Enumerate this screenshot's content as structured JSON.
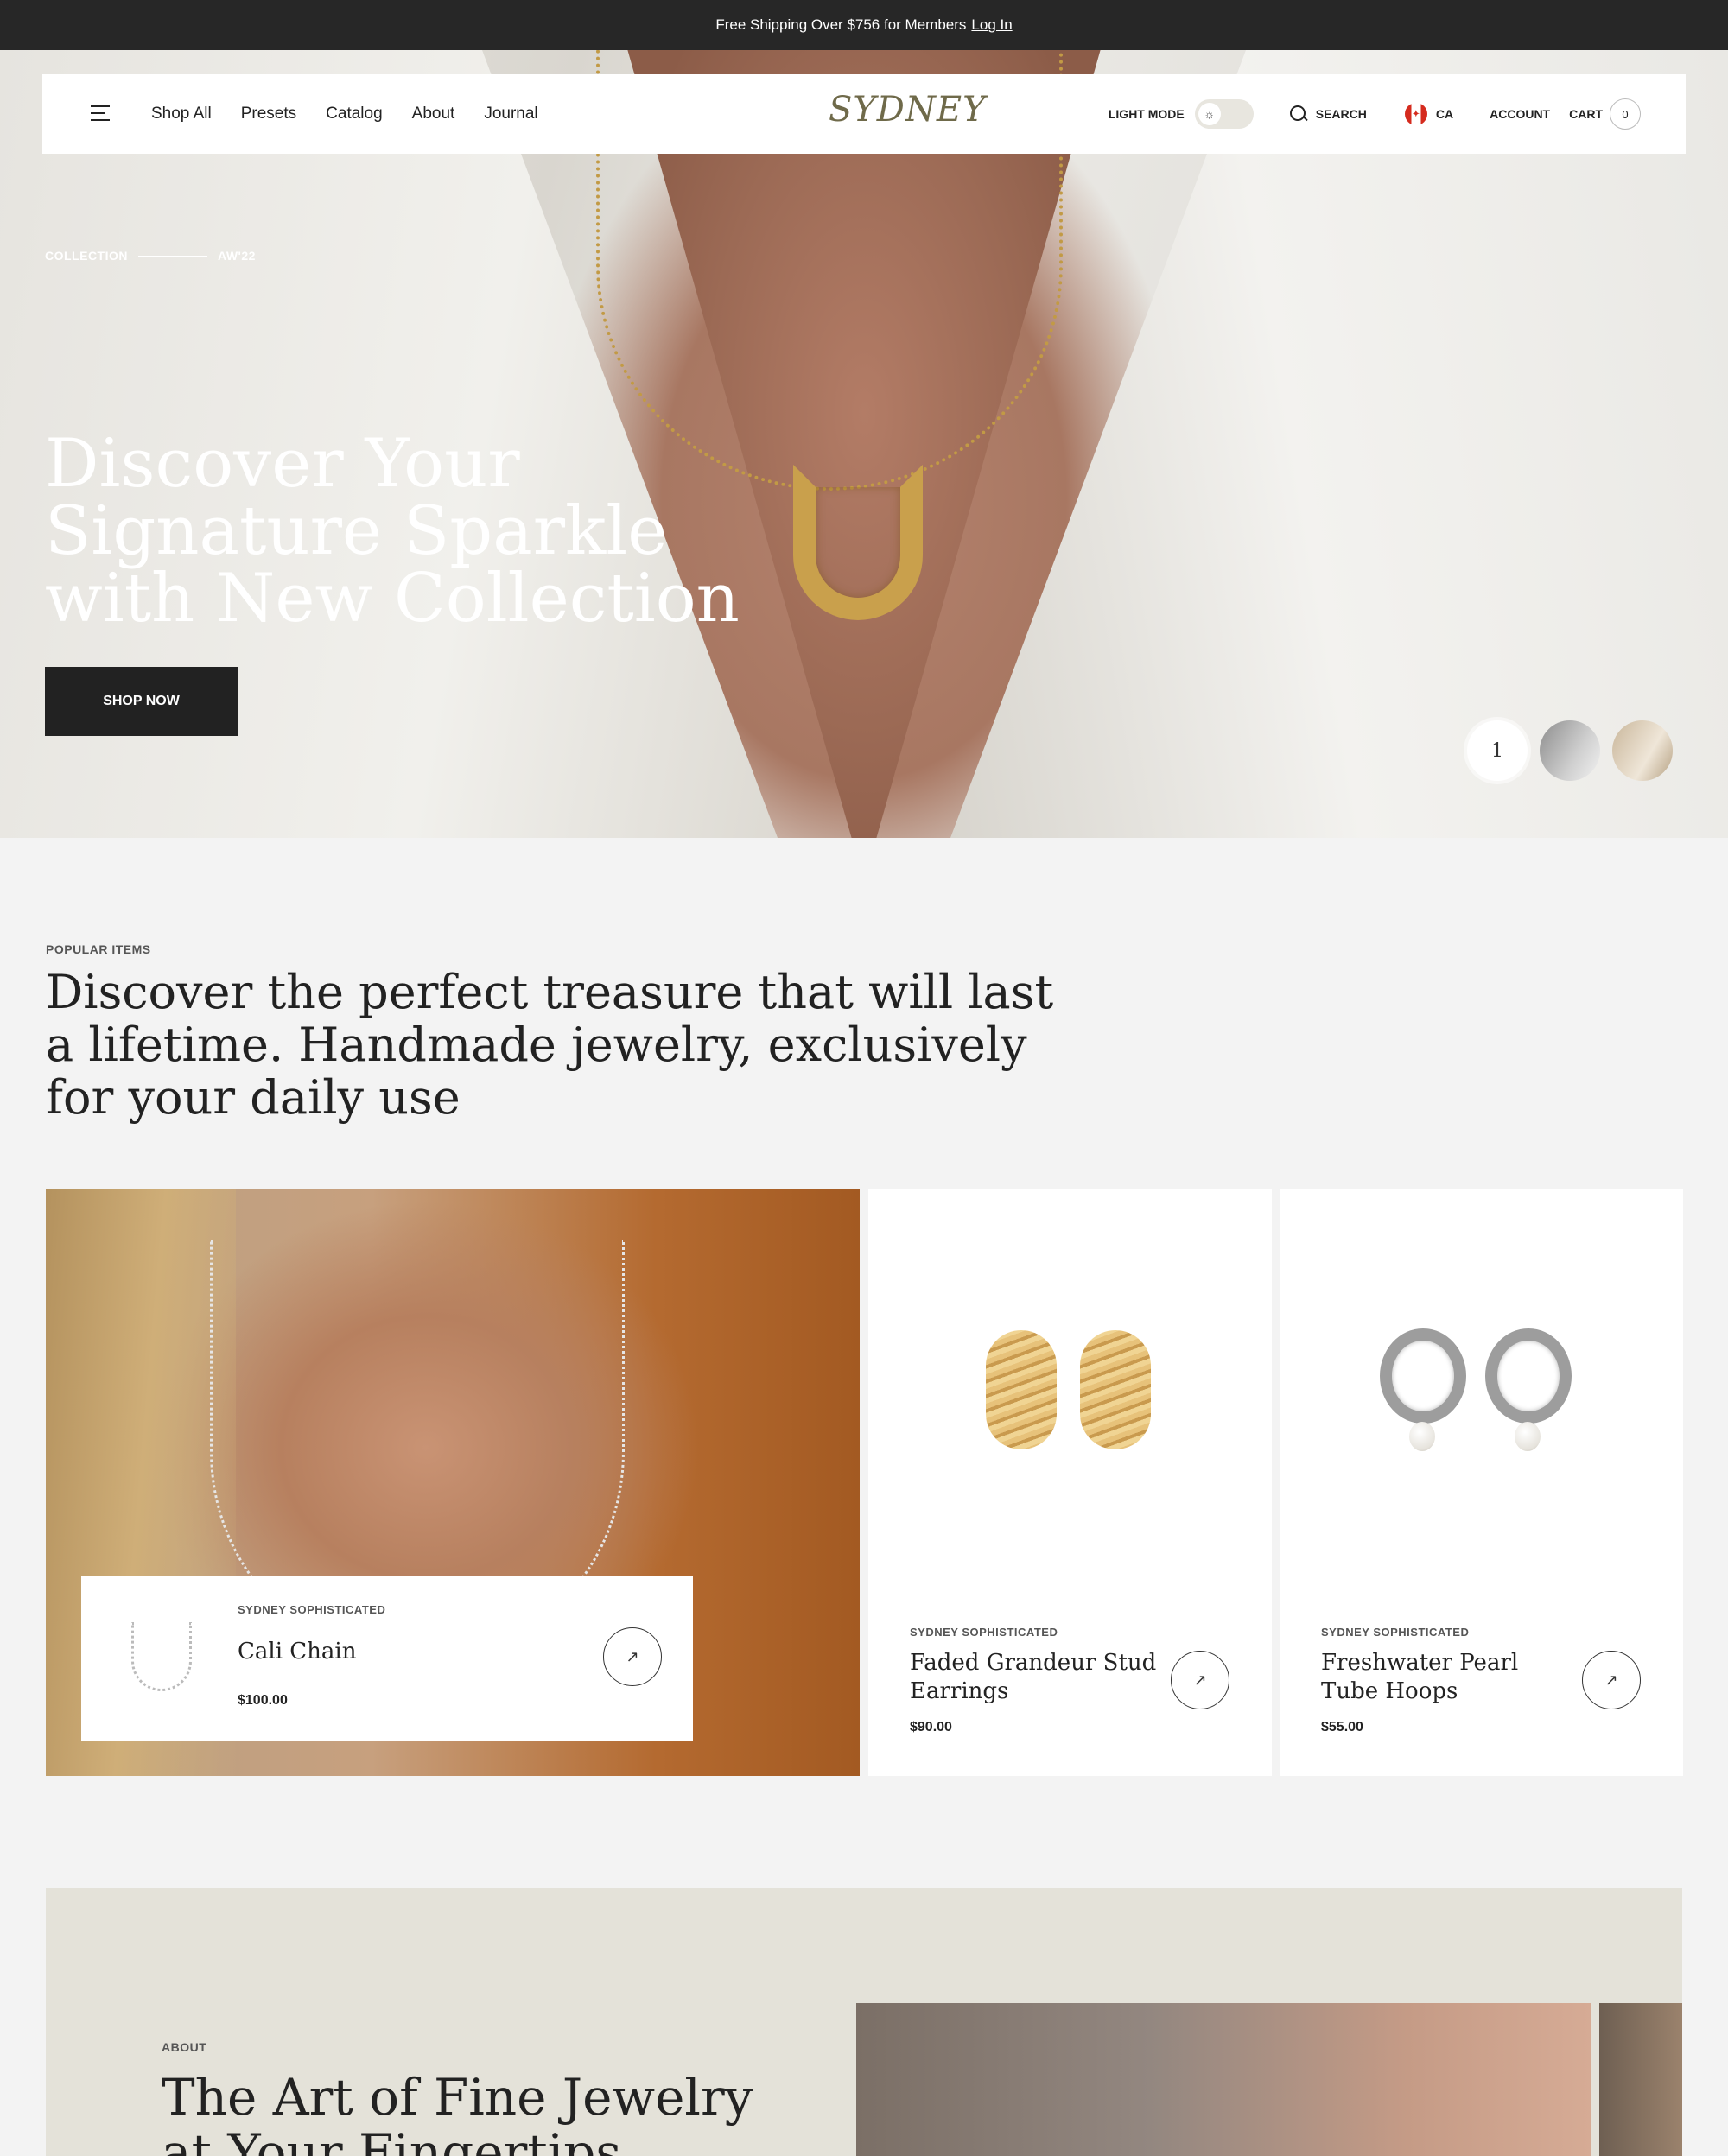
{
  "announcement": {
    "text": "Free Shipping Over $756 for Members",
    "link": "Log In"
  },
  "nav": {
    "links": [
      "Shop All",
      "Presets",
      "Catalog",
      "About",
      "Journal"
    ],
    "logo": "SYDNEY",
    "light_mode": "LIGHT MODE",
    "search": "SEARCH",
    "country": "CA",
    "account": "ACCOUNT",
    "cart": "CART",
    "cart_count": "0"
  },
  "hero": {
    "kicker_left": "COLLECTION",
    "kicker_right": "AW'22",
    "title": "Discover Your Signature Sparkle with New Collection",
    "cta": "SHOP NOW",
    "active_slide": "1"
  },
  "popular": {
    "kicker": "POPULAR ITEMS",
    "title": "Discover the perfect treasure that will last a lifetime. Handmade jewelry, exclusively for your daily use",
    "featured": {
      "brand": "SYDNEY SOPHISTICATED",
      "name": "Cali Chain",
      "price": "$100.00"
    },
    "products": [
      {
        "brand": "SYDNEY SOPHISTICATED",
        "name": "Faded Grandeur Stud Earrings",
        "price": "$90.00"
      },
      {
        "brand": "SYDNEY SOPHISTICATED",
        "name": "Freshwater Pearl Tube Hoops",
        "price": "$55.00"
      }
    ]
  },
  "about": {
    "kicker": "ABOUT",
    "title": "The Art of Fine Jewelry at Your Fingertips. Discover"
  },
  "icons": {
    "arrow": "↗",
    "sun": "☼"
  }
}
